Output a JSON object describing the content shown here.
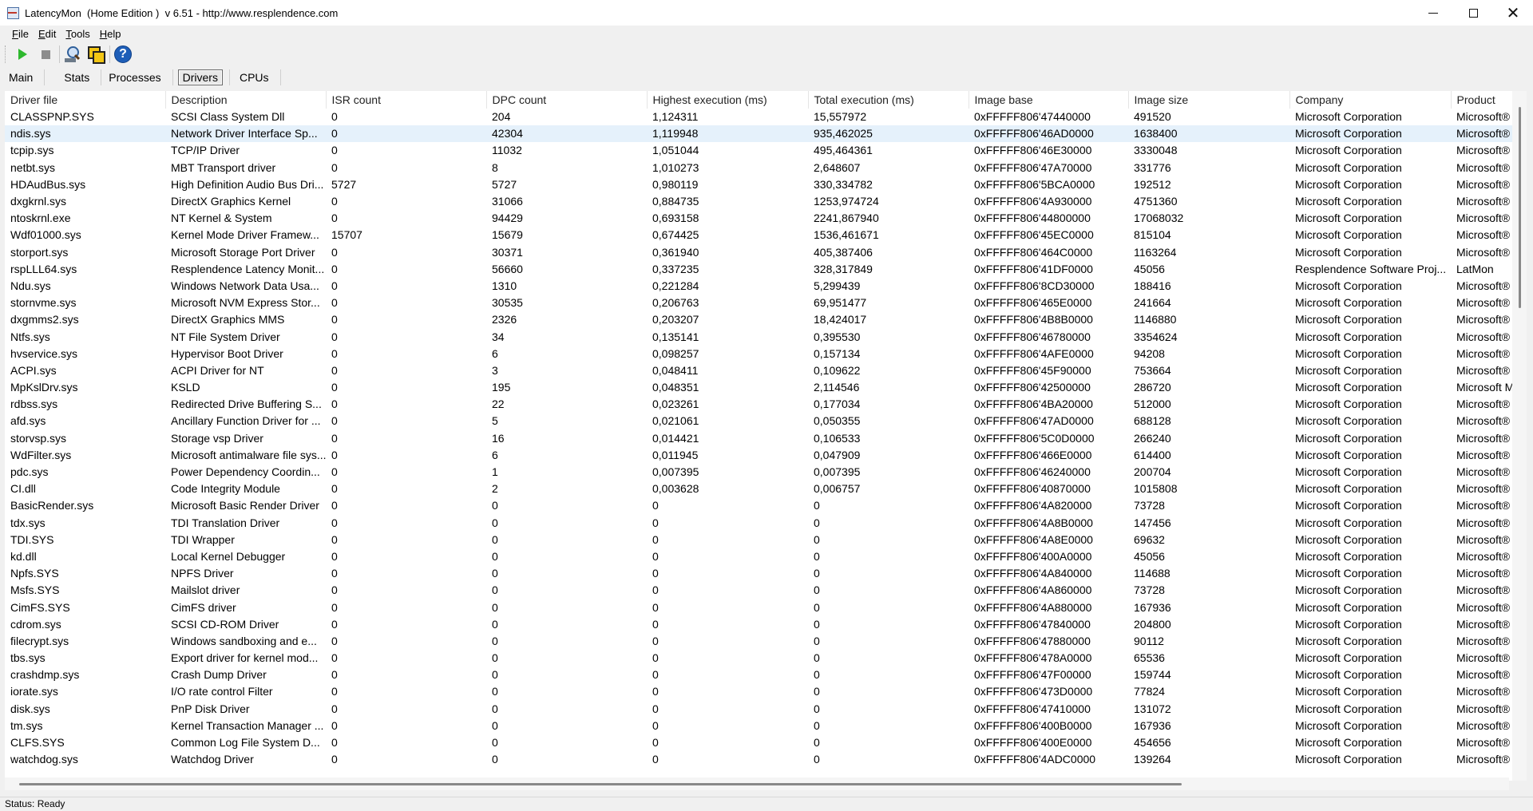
{
  "window": {
    "title": "LatencyMon  (Home Edition )  v 6.51 - http://www.resplendence.com",
    "minimize_icon": "minimize-icon",
    "maximize_icon": "maximize-icon",
    "close_icon": "close-icon"
  },
  "menu": {
    "items": [
      {
        "label": "File",
        "accel": "F"
      },
      {
        "label": "Edit",
        "accel": "E"
      },
      {
        "label": "Tools",
        "accel": "T"
      },
      {
        "label": "Help",
        "accel": "H"
      }
    ]
  },
  "toolbar": {
    "buttons": [
      "play-icon",
      "stop-icon",
      "magnifier-icon",
      "copy-icon",
      "help-icon"
    ],
    "help_glyph": "?"
  },
  "tabs": {
    "items": [
      "Main",
      "Stats",
      "Processes",
      "Drivers",
      "CPUs"
    ],
    "active": "Drivers"
  },
  "table": {
    "columns": [
      "Driver file",
      "Description",
      "ISR count",
      "DPC count",
      "Highest execution (ms)",
      "Total execution (ms)",
      "Image base",
      "Image size",
      "Company",
      "Product"
    ],
    "selected_row": 1,
    "rows": [
      [
        "CLASSPNP.SYS",
        "SCSI Class System Dll",
        "0",
        "204",
        "1,124311",
        "15,557972",
        "0xFFFFF806'47440000",
        "491520",
        "Microsoft Corporation",
        "Microsoft®"
      ],
      [
        "ndis.sys",
        "Network Driver Interface Sp...",
        "0",
        "42304",
        "1,119948",
        "935,462025",
        "0xFFFFF806'46AD0000",
        "1638400",
        "Microsoft Corporation",
        "Microsoft®"
      ],
      [
        "tcpip.sys",
        "TCP/IP Driver",
        "0",
        "11032",
        "1,051044",
        "495,464361",
        "0xFFFFF806'46E30000",
        "3330048",
        "Microsoft Corporation",
        "Microsoft®"
      ],
      [
        "netbt.sys",
        "MBT Transport driver",
        "0",
        "8",
        "1,010273",
        "2,648607",
        "0xFFFFF806'47A70000",
        "331776",
        "Microsoft Corporation",
        "Microsoft®"
      ],
      [
        "HDAudBus.sys",
        "High Definition Audio Bus Dri...",
        "5727",
        "5727",
        "0,980119",
        "330,334782",
        "0xFFFFF806'5BCA0000",
        "192512",
        "Microsoft Corporation",
        "Microsoft®"
      ],
      [
        "dxgkrnl.sys",
        "DirectX Graphics Kernel",
        "0",
        "31066",
        "0,884735",
        "1253,974724",
        "0xFFFFF806'4A930000",
        "4751360",
        "Microsoft Corporation",
        "Microsoft®"
      ],
      [
        "ntoskrnl.exe",
        "NT Kernel & System",
        "0",
        "94429",
        "0,693158",
        "2241,867940",
        "0xFFFFF806'44800000",
        "17068032",
        "Microsoft Corporation",
        "Microsoft®"
      ],
      [
        "Wdf01000.sys",
        "Kernel Mode Driver Framew...",
        "15707",
        "15679",
        "0,674425",
        "1536,461671",
        "0xFFFFF806'45EC0000",
        "815104",
        "Microsoft Corporation",
        "Microsoft®"
      ],
      [
        "storport.sys",
        "Microsoft Storage Port Driver",
        "0",
        "30371",
        "0,361940",
        "405,387406",
        "0xFFFFF806'464C0000",
        "1163264",
        "Microsoft Corporation",
        "Microsoft®"
      ],
      [
        "rspLLL64.sys",
        "Resplendence Latency Monit...",
        "0",
        "56660",
        "0,337235",
        "328,317849",
        "0xFFFFF806'41DF0000",
        "45056",
        "Resplendence Software Proj...",
        "LatMon"
      ],
      [
        "Ndu.sys",
        "Windows Network Data Usa...",
        "0",
        "1310",
        "0,221284",
        "5,299439",
        "0xFFFFF806'8CD30000",
        "188416",
        "Microsoft Corporation",
        "Microsoft®"
      ],
      [
        "stornvme.sys",
        "Microsoft NVM Express Stor...",
        "0",
        "30535",
        "0,206763",
        "69,951477",
        "0xFFFFF806'465E0000",
        "241664",
        "Microsoft Corporation",
        "Microsoft®"
      ],
      [
        "dxgmms2.sys",
        "DirectX Graphics MMS",
        "0",
        "2326",
        "0,203207",
        "18,424017",
        "0xFFFFF806'4B8B0000",
        "1146880",
        "Microsoft Corporation",
        "Microsoft®"
      ],
      [
        "Ntfs.sys",
        "NT File System Driver",
        "0",
        "34",
        "0,135141",
        "0,395530",
        "0xFFFFF806'46780000",
        "3354624",
        "Microsoft Corporation",
        "Microsoft®"
      ],
      [
        "hvservice.sys",
        "Hypervisor Boot Driver",
        "0",
        "6",
        "0,098257",
        "0,157134",
        "0xFFFFF806'4AFE0000",
        "94208",
        "Microsoft Corporation",
        "Microsoft®"
      ],
      [
        "ACPI.sys",
        "ACPI Driver for NT",
        "0",
        "3",
        "0,048411",
        "0,109622",
        "0xFFFFF806'45F90000",
        "753664",
        "Microsoft Corporation",
        "Microsoft®"
      ],
      [
        "MpKslDrv.sys",
        "KSLD",
        "0",
        "195",
        "0,048351",
        "2,114546",
        "0xFFFFF806'42500000",
        "286720",
        "Microsoft Corporation",
        "Microsoft M"
      ],
      [
        "rdbss.sys",
        "Redirected Drive Buffering S...",
        "0",
        "22",
        "0,023261",
        "0,177034",
        "0xFFFFF806'4BA20000",
        "512000",
        "Microsoft Corporation",
        "Microsoft®"
      ],
      [
        "afd.sys",
        "Ancillary Function Driver for ...",
        "0",
        "5",
        "0,021061",
        "0,050355",
        "0xFFFFF806'47AD0000",
        "688128",
        "Microsoft Corporation",
        "Microsoft®"
      ],
      [
        "storvsp.sys",
        "Storage vsp Driver",
        "0",
        "16",
        "0,014421",
        "0,106533",
        "0xFFFFF806'5C0D0000",
        "266240",
        "Microsoft Corporation",
        "Microsoft®"
      ],
      [
        "WdFilter.sys",
        "Microsoft antimalware file sys...",
        "0",
        "6",
        "0,011945",
        "0,047909",
        "0xFFFFF806'466E0000",
        "614400",
        "Microsoft Corporation",
        "Microsoft®"
      ],
      [
        "pdc.sys",
        "Power Dependency Coordin...",
        "0",
        "1",
        "0,007395",
        "0,007395",
        "0xFFFFF806'46240000",
        "200704",
        "Microsoft Corporation",
        "Microsoft®"
      ],
      [
        "CI.dll",
        "Code Integrity Module",
        "0",
        "2",
        "0,003628",
        "0,006757",
        "0xFFFFF806'40870000",
        "1015808",
        "Microsoft Corporation",
        "Microsoft®"
      ],
      [
        "BasicRender.sys",
        "Microsoft Basic Render Driver",
        "0",
        "0",
        "0",
        "0",
        "0xFFFFF806'4A820000",
        "73728",
        "Microsoft Corporation",
        "Microsoft®"
      ],
      [
        "tdx.sys",
        "TDI Translation Driver",
        "0",
        "0",
        "0",
        "0",
        "0xFFFFF806'4A8B0000",
        "147456",
        "Microsoft Corporation",
        "Microsoft®"
      ],
      [
        "TDI.SYS",
        "TDI Wrapper",
        "0",
        "0",
        "0",
        "0",
        "0xFFFFF806'4A8E0000",
        "69632",
        "Microsoft Corporation",
        "Microsoft®"
      ],
      [
        "kd.dll",
        "Local Kernel Debugger",
        "0",
        "0",
        "0",
        "0",
        "0xFFFFF806'400A0000",
        "45056",
        "Microsoft Corporation",
        "Microsoft®"
      ],
      [
        "Npfs.SYS",
        "NPFS Driver",
        "0",
        "0",
        "0",
        "0",
        "0xFFFFF806'4A840000",
        "114688",
        "Microsoft Corporation",
        "Microsoft®"
      ],
      [
        "Msfs.SYS",
        "Mailslot driver",
        "0",
        "0",
        "0",
        "0",
        "0xFFFFF806'4A860000",
        "73728",
        "Microsoft Corporation",
        "Microsoft®"
      ],
      [
        "CimFS.SYS",
        "CimFS driver",
        "0",
        "0",
        "0",
        "0",
        "0xFFFFF806'4A880000",
        "167936",
        "Microsoft Corporation",
        "Microsoft®"
      ],
      [
        "cdrom.sys",
        "SCSI CD-ROM Driver",
        "0",
        "0",
        "0",
        "0",
        "0xFFFFF806'47840000",
        "204800",
        "Microsoft Corporation",
        "Microsoft®"
      ],
      [
        "filecrypt.sys",
        "Windows sandboxing and e...",
        "0",
        "0",
        "0",
        "0",
        "0xFFFFF806'47880000",
        "90112",
        "Microsoft Corporation",
        "Microsoft®"
      ],
      [
        "tbs.sys",
        "Export driver for kernel mod...",
        "0",
        "0",
        "0",
        "0",
        "0xFFFFF806'478A0000",
        "65536",
        "Microsoft Corporation",
        "Microsoft®"
      ],
      [
        "crashdmp.sys",
        "Crash Dump Driver",
        "0",
        "0",
        "0",
        "0",
        "0xFFFFF806'47F00000",
        "159744",
        "Microsoft Corporation",
        "Microsoft®"
      ],
      [
        "iorate.sys",
        "I/O rate control Filter",
        "0",
        "0",
        "0",
        "0",
        "0xFFFFF806'473D0000",
        "77824",
        "Microsoft Corporation",
        "Microsoft®"
      ],
      [
        "disk.sys",
        "PnP Disk Driver",
        "0",
        "0",
        "0",
        "0",
        "0xFFFFF806'47410000",
        "131072",
        "Microsoft Corporation",
        "Microsoft®"
      ],
      [
        "tm.sys",
        "Kernel Transaction Manager ...",
        "0",
        "0",
        "0",
        "0",
        "0xFFFFF806'400B0000",
        "167936",
        "Microsoft Corporation",
        "Microsoft®"
      ],
      [
        "CLFS.SYS",
        "Common Log File System D...",
        "0",
        "0",
        "0",
        "0",
        "0xFFFFF806'400E0000",
        "454656",
        "Microsoft Corporation",
        "Microsoft®"
      ],
      [
        "watchdog.sys",
        "Watchdog Driver",
        "0",
        "0",
        "0",
        "0",
        "0xFFFFF806'4ADC0000",
        "139264",
        "Microsoft Corporation",
        "Microsoft®"
      ]
    ]
  },
  "status": {
    "text": "Status: Ready"
  }
}
